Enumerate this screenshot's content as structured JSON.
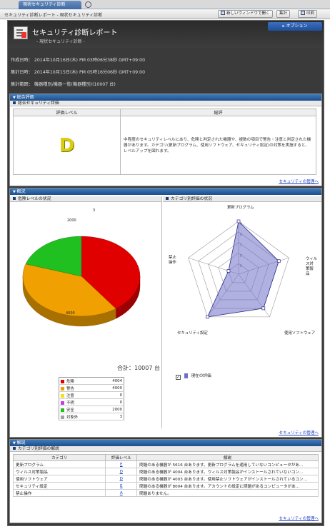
{
  "browser": {
    "tab_label": "現状セキュリティ診断",
    "breadcrumb": "セキュリティ診断レポート - 現状セキュリティ診断",
    "new_window_label": "新しいウィンドウで開く",
    "aggregate_label": "集計",
    "print_label": "印刷"
  },
  "report": {
    "title": "セキュリティ診断レポート",
    "subtitle": "- 現状セキュリティ診断 -",
    "option_label": "▸ オプション",
    "created": "作成日時：  2014年10月16日(木) PM 03時06分38秒 GMT+09:00",
    "aggregated": "集計日時：  2014年10月15日(木) PM 05時16分06秒 GMT+09:00",
    "scope": "集計範囲：  機器種別/機器一覧(機器種別)(10007 台)"
  },
  "overall": {
    "section_title": "総合評価",
    "sub_title": "総合セキュリティ評価",
    "col_level": "評価レベル",
    "col_comment": "総評",
    "grade": "D",
    "comment": "中程度のセキュリティレベルにあり、危険と判定された機器や、複数の項目で警告・注意と判定された機器があります。カテゴリ(更新プログラム、使用ソフトウェア、セキュリティ設定)の対策を実施すると、レベルアップを図れます。",
    "link": "セキュリティの管理へ"
  },
  "summary": {
    "section_title": "概況",
    "risk_title": "危険レベルの状況",
    "category_title": "カテゴリ別評価の状況",
    "total": "合計：10007 台",
    "link": "セキュリティの管理へ"
  },
  "chart_data": [
    {
      "type": "pie",
      "title": "危険レベルの状況",
      "slices": [
        {
          "name": "危険",
          "value": 4004,
          "color": "#e00000"
        },
        {
          "name": "警告",
          "value": 4000,
          "color": "#f0a000"
        },
        {
          "name": "注意",
          "value": 0,
          "color": "#f0e020"
        },
        {
          "name": "不明",
          "value": 0,
          "color": "#c040e0"
        },
        {
          "name": "安全",
          "value": 2000,
          "color": "#20c020"
        },
        {
          "name": "対象外",
          "value": 3,
          "color": "#a0a0a0"
        }
      ],
      "data_labels": [
        "3",
        "2000",
        "4004",
        "4000"
      ]
    },
    {
      "type": "radar",
      "title": "カテゴリ別評価の状況",
      "axes": [
        "更新プログラム",
        "ウィルス対策製品",
        "使用ソフトウェア",
        "セキュリティ設定",
        "禁止操作"
      ],
      "ticks": [
        "A",
        "B",
        "C",
        "D",
        "E"
      ],
      "series": [
        {
          "name": "現在の評価",
          "values": [
            1,
            2,
            2,
            1,
            5
          ],
          "color": "#7070c8"
        }
      ]
    }
  ],
  "details": {
    "section_title": "解説",
    "sub_title": "カテゴリ別評価の解説",
    "headers": [
      "カテゴリ",
      "評価レベル",
      "解説"
    ],
    "rows": [
      {
        "category": "更新プログラム",
        "level": "E",
        "desc": "問題のある機器が 5616 台あります。更新プログラムを適用していないコンピュータがあ..."
      },
      {
        "category": "ウィルス対策製品",
        "level": "D",
        "desc": "問題のある機器が 4004 台あります。ウィルス対策製品がインストールされていないコン..."
      },
      {
        "category": "使用ソフトウェア",
        "level": "D",
        "desc": "問題のある機器が 4003 台あります。使用禁止ソフトウェアがインストールされているコン..."
      },
      {
        "category": "セキュリティ設定",
        "level": "E",
        "desc": "問題のある機器が 8004 台あります。アカウントの設定に問題があるコンピュータがあ..."
      },
      {
        "category": "禁止操作",
        "level": "A",
        "desc": "問題ありません。"
      }
    ],
    "link": "セキュリティの管理へ"
  }
}
